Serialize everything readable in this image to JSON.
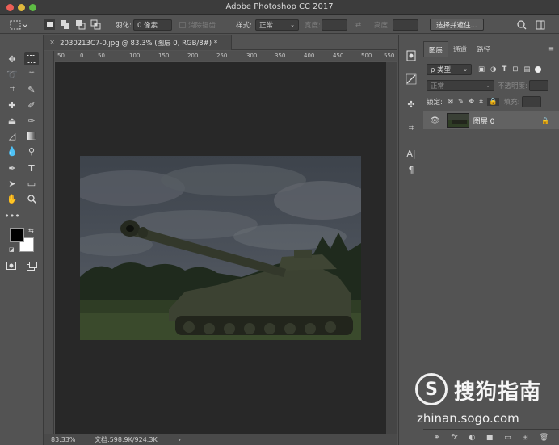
{
  "window": {
    "title": "Adobe Photoshop CC 2017"
  },
  "options_bar": {
    "feather_label": "羽化:",
    "feather_value": "0 像素",
    "antialias_label": "消除锯齿",
    "style_label": "样式:",
    "style_value": "正常",
    "width_label": "宽度:",
    "height_label": "高度:",
    "select_mask_button": "选择并遮住..."
  },
  "document": {
    "tab_title": "2030213C7-0.jpg @ 83.3% (图层 0, RGB/8#) *",
    "ruler_ticks": [
      "50",
      "0",
      "50",
      "100",
      "150",
      "200",
      "250",
      "300",
      "350",
      "400",
      "450",
      "500",
      "550"
    ],
    "zoom": "83.33%",
    "doc_size": "文档:598.9K/924.3K",
    "nav_arrow": "›"
  },
  "layers_panel": {
    "tabs": [
      "图层",
      "通道",
      "路径"
    ],
    "filter_label": "ρ 类型",
    "blend_mode": "正常",
    "opacity_label": "不透明度:",
    "lock_label": "锁定:",
    "fill_label": "填充:",
    "layer_name": "图层 0",
    "bottom_icons": [
      "fx",
      "◐",
      "■",
      "▭",
      "⊞",
      "🗑"
    ]
  },
  "watermark": {
    "logo_letter": "S",
    "brand": "搜狗指南",
    "url": "zhinan.sogo.com"
  },
  "colors": {
    "ui_bg": "#535353",
    "canvas_bg": "#282828",
    "foreground": "#000000",
    "background": "#ffffff"
  }
}
